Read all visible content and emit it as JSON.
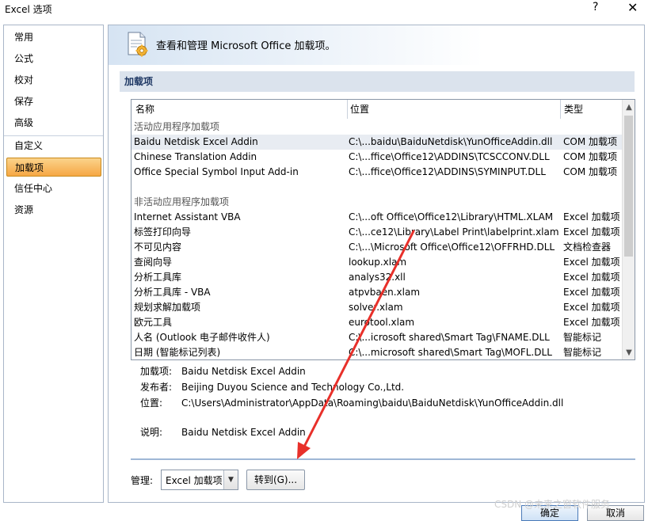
{
  "window": {
    "title": "Excel 选项",
    "help_glyph": "?",
    "close_glyph": "✕"
  },
  "nav": {
    "items": [
      {
        "label": "常用"
      },
      {
        "label": "公式"
      },
      {
        "label": "校对"
      },
      {
        "label": "保存"
      },
      {
        "label": "高级"
      },
      {
        "label": "自定义"
      },
      {
        "label": "加载项"
      },
      {
        "label": "信任中心"
      },
      {
        "label": "资源"
      }
    ],
    "active_index": 6
  },
  "header": {
    "text": "查看和管理 Microsoft Office 加载项。"
  },
  "section": {
    "title": "加载项"
  },
  "table": {
    "columns": {
      "name": "名称",
      "location": "位置",
      "type": "类型"
    },
    "groups": {
      "active": "活动应用程序加载项",
      "inactive": "非活动应用程序加载项"
    },
    "active_rows": [
      {
        "name": "Baidu Netdisk Excel Addin",
        "location": "C:\\...baidu\\BaiduNetdisk\\YunOfficeAddin.dll",
        "type": "COM 加载项"
      },
      {
        "name": "Chinese Translation Addin",
        "location": "C:\\...ffice\\Office12\\ADDINS\\TCSCCONV.DLL",
        "type": "COM 加载项"
      },
      {
        "name": "Office Special Symbol Input Add-in",
        "location": "C:\\...ffice\\Office12\\ADDINS\\SYMINPUT.DLL",
        "type": "COM 加载项"
      }
    ],
    "inactive_rows": [
      {
        "name": "Internet Assistant VBA",
        "location": "C:\\...oft Office\\Office12\\Library\\HTML.XLAM",
        "type": "Excel 加载项"
      },
      {
        "name": "标签打印向导",
        "location": "C:\\...ce12\\Library\\Label Print\\labelprint.xlam",
        "type": "Excel 加载项"
      },
      {
        "name": "不可见内容",
        "location": "C:\\...\\Microsoft Office\\Office12\\OFFRHD.DLL",
        "type": "文档检查器"
      },
      {
        "name": "查阅向导",
        "location": "lookup.xlam",
        "type": "Excel 加载项"
      },
      {
        "name": "分析工具库",
        "location": "analys32.xll",
        "type": "Excel 加载项"
      },
      {
        "name": "分析工具库 - VBA",
        "location": "atpvbaen.xlam",
        "type": "Excel 加载项"
      },
      {
        "name": "规划求解加载项",
        "location": "solver.xlam",
        "type": "Excel 加载项"
      },
      {
        "name": "欧元工具",
        "location": "eurotool.xlam",
        "type": "Excel 加载项"
      },
      {
        "name": "人名 (Outlook 电子邮件收件人)",
        "location": "C:\\...icrosoft shared\\Smart Tag\\FNAME.DLL",
        "type": "智能标记"
      },
      {
        "name": "日期 (智能标记列表)",
        "location": "C:\\...microsoft shared\\Smart Tag\\MOFL.DLL",
        "type": "智能标记"
      }
    ]
  },
  "details": {
    "addin_label": "加载项:",
    "addin_value": "Baidu Netdisk Excel Addin",
    "publisher_label": "发布者:",
    "publisher_value": "Beijing Duyou Science and Technology Co.,Ltd.",
    "location_label": "位置:",
    "location_value": "C:\\Users\\Administrator\\AppData\\Roaming\\baidu\\BaiduNetdisk\\YunOfficeAddin.dll",
    "description_label": "说明:",
    "description_value": "Baidu Netdisk Excel Addin"
  },
  "manage": {
    "label": "管理:",
    "selected": "Excel 加载项",
    "go_button": "转到(G)..."
  },
  "footer": {
    "ok": "确定",
    "cancel": "取消"
  },
  "watermark": "CSDN @未来之窗软件服务",
  "colors": {
    "annotation_arrow": "#e8302a",
    "nav_active": "#f6a744"
  }
}
